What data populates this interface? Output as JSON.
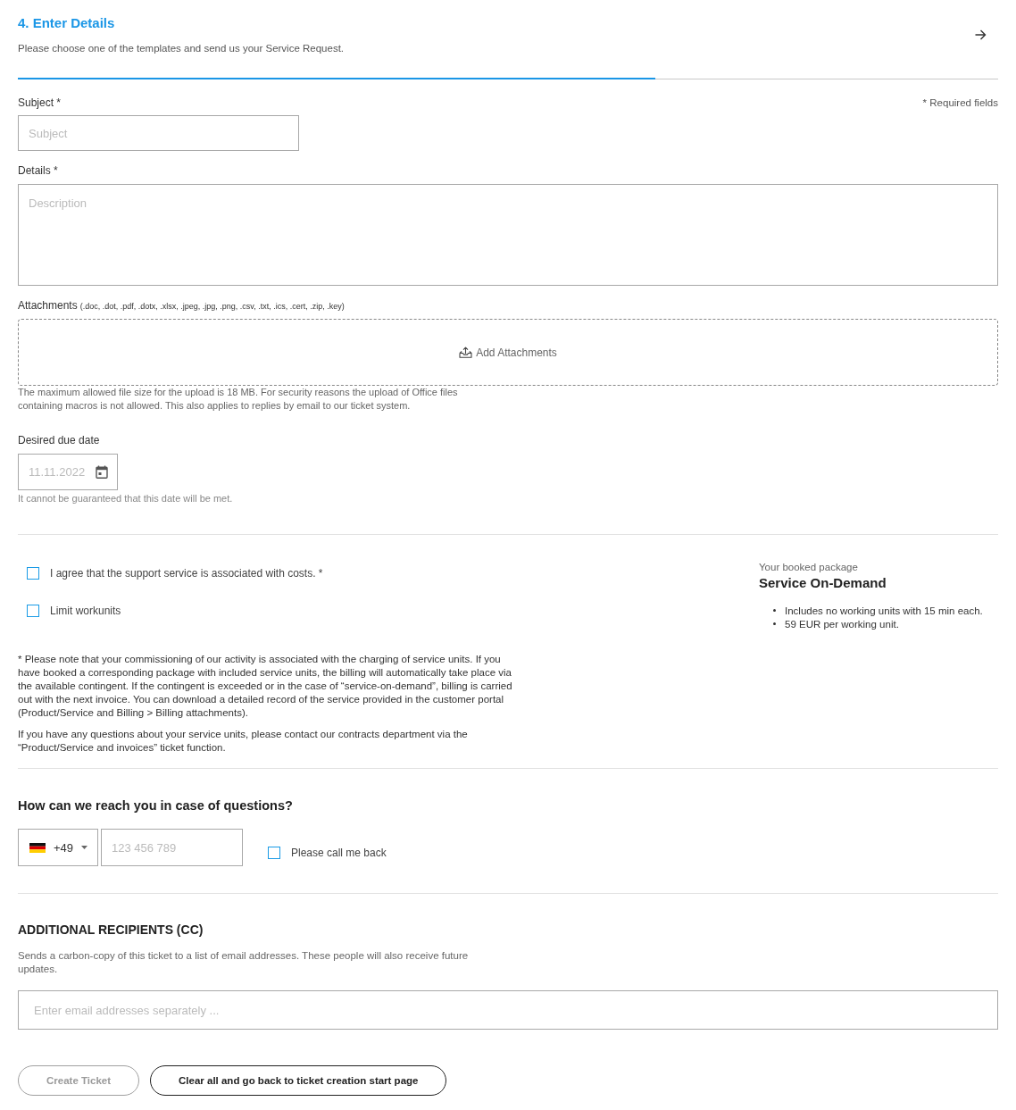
{
  "step": {
    "title": "4. Enter Details",
    "subtitle": "Please choose one of the templates and send us your Service Request.",
    "progress": {
      "level": 0.65
    }
  },
  "required_note": "* Required fields",
  "subject": {
    "label": "Subject *",
    "placeholder": "Subject"
  },
  "details": {
    "label": "Details *",
    "placeholder": "Description"
  },
  "attachments": {
    "label": "Attachments",
    "formats": "(.doc, .dot, .pdf, .dotx, .xlsx, .jpeg, .jpg, .png, .csv, .txt, .ics, .cert, .zip, .key)",
    "button": "Add Attachments",
    "note": "The maximum allowed file size for the upload is 18 MB. For security reasons the upload of Office files containing macros is not allowed. This also applies to replies by email to our ticket system."
  },
  "due_date": {
    "label": "Desired due date",
    "placeholder": "11.11.2022",
    "hint": "It cannot be guaranteed that this date will be met."
  },
  "agreements": [
    {
      "label": "I agree that the support service is associated with costs. *",
      "checked": false
    },
    {
      "label": "Limit workunits",
      "checked": false
    }
  ],
  "package": {
    "caption": "Your booked package",
    "name": "Service On-Demand",
    "features": [
      "Includes no working units with 15 min each.",
      "59 EUR per working unit."
    ]
  },
  "notes": [
    "* Please note that your commissioning of our activity is associated with the charging of service units. If you have booked a corresponding package with included service units, the billing will automatically take place via the available contingent. If the contingent is exceeded or in the case of “service-on-demand”, billing is carried out with the next invoice. You can download a detailed record of the service provided in the customer portal (Product/Service and Billing > Billing attachments).",
    "If you have any questions about your service units, please contact our contracts department via the “Product/Service and invoices” ticket function."
  ],
  "contact": {
    "heading": "How can we reach you in case of questions?",
    "country_code": "+49",
    "phone_placeholder": "123 456 789",
    "callback": {
      "label": "Please call me back",
      "checked": false
    }
  },
  "cc": {
    "heading": "ADDITIONAL RECIPIENTS (CC)",
    "description": "Sends a carbon-copy of this ticket to a list of email addresses. These people will also receive future updates.",
    "placeholder": "Enter email addresses separately ..."
  },
  "buttons": [
    {
      "label": "Create Ticket",
      "disabled": true
    },
    {
      "label": "Clear all and go back to ticket creation start page",
      "disabled": false
    }
  ]
}
